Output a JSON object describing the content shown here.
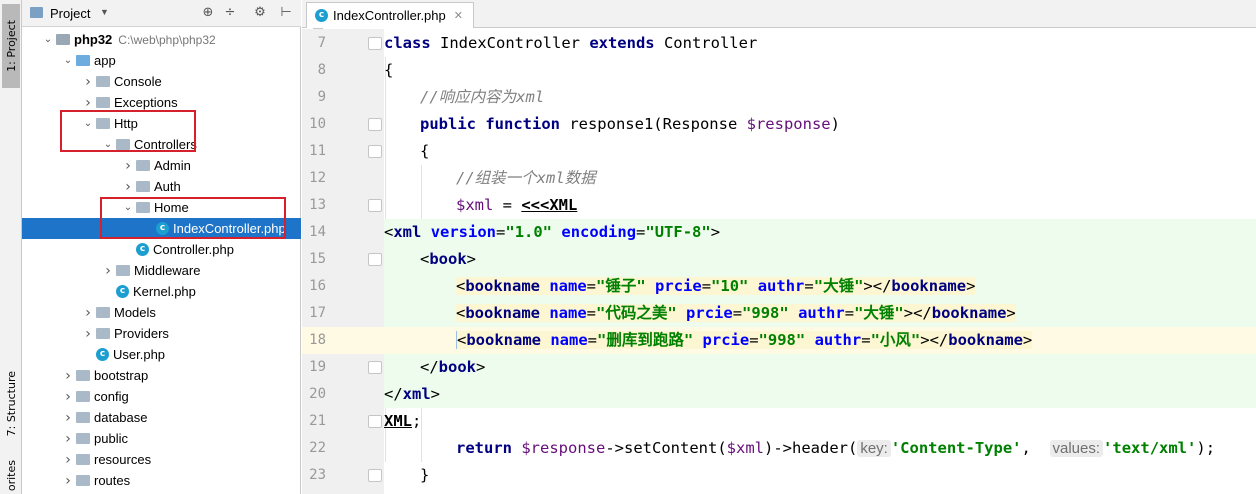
{
  "left_strip": {
    "project_tab": "1: Project",
    "structure_tab": "7: Structure",
    "favorites_tab": "orites"
  },
  "project_panel": {
    "title": "Project",
    "header_icons": [
      "target-icon",
      "collapse-icon",
      "gear-icon",
      "hide-icon"
    ],
    "tree": [
      {
        "label": "php32",
        "path": "C:\\web\\php\\php32",
        "depth": 0,
        "expanded": true,
        "type": "project",
        "bold": true
      },
      {
        "label": "app",
        "depth": 1,
        "expanded": true,
        "type": "folder-blue"
      },
      {
        "label": "Console",
        "depth": 2,
        "expanded": false,
        "type": "folder"
      },
      {
        "label": "Exceptions",
        "depth": 2,
        "expanded": false,
        "type": "folder"
      },
      {
        "label": "Http",
        "depth": 2,
        "expanded": true,
        "type": "folder"
      },
      {
        "label": "Controllers",
        "depth": 3,
        "expanded": true,
        "type": "folder"
      },
      {
        "label": "Admin",
        "depth": 4,
        "expanded": false,
        "type": "folder"
      },
      {
        "label": "Auth",
        "depth": 4,
        "expanded": false,
        "type": "folder"
      },
      {
        "label": "Home",
        "depth": 4,
        "expanded": true,
        "type": "folder"
      },
      {
        "label": "IndexController.php",
        "depth": 5,
        "type": "class",
        "selected": true
      },
      {
        "label": "Controller.php",
        "depth": 4,
        "type": "class"
      },
      {
        "label": "Middleware",
        "depth": 3,
        "expanded": false,
        "type": "folder"
      },
      {
        "label": "Kernel.php",
        "depth": 3,
        "type": "class"
      },
      {
        "label": "Models",
        "depth": 2,
        "expanded": false,
        "type": "folder"
      },
      {
        "label": "Providers",
        "depth": 2,
        "expanded": false,
        "type": "folder"
      },
      {
        "label": "User.php",
        "depth": 2,
        "type": "class"
      },
      {
        "label": "bootstrap",
        "depth": 1,
        "expanded": false,
        "type": "folder"
      },
      {
        "label": "config",
        "depth": 1,
        "expanded": false,
        "type": "folder"
      },
      {
        "label": "database",
        "depth": 1,
        "expanded": false,
        "type": "folder"
      },
      {
        "label": "public",
        "depth": 1,
        "expanded": false,
        "type": "folder"
      },
      {
        "label": "resources",
        "depth": 1,
        "expanded": false,
        "type": "folder"
      },
      {
        "label": "routes",
        "depth": 1,
        "expanded": false,
        "type": "folder"
      }
    ]
  },
  "editor": {
    "tab_label": "IndexController.php",
    "current_line": 18,
    "lines": [
      {
        "n": "7",
        "fold": true,
        "indent": 0,
        "segs": [
          [
            "kw",
            "class"
          ],
          [
            "t",
            " IndexController "
          ],
          [
            "kw",
            "extends"
          ],
          [
            "t",
            " Controller"
          ]
        ]
      },
      {
        "n": "8",
        "fold": false,
        "indent": 0,
        "segs": [
          [
            "t",
            "{"
          ]
        ]
      },
      {
        "n": "9",
        "fold": false,
        "indent": 1,
        "segs": [
          [
            "cmt",
            "//响应内容为xml"
          ]
        ]
      },
      {
        "n": "10",
        "fold": true,
        "indent": 1,
        "segs": [
          [
            "kw",
            "public function"
          ],
          [
            "t",
            " response1(Response "
          ],
          [
            "var",
            "$response"
          ],
          [
            "t",
            ")"
          ]
        ]
      },
      {
        "n": "11",
        "fold": true,
        "indent": 1,
        "segs": [
          [
            "t",
            "{"
          ]
        ]
      },
      {
        "n": "12",
        "fold": false,
        "indent": 2,
        "segs": [
          [
            "cmt",
            "//组装一个xml数据"
          ]
        ]
      },
      {
        "n": "13",
        "fold": true,
        "indent": 2,
        "segs": [
          [
            "var",
            "$xml"
          ],
          [
            "t",
            " = "
          ],
          [
            "heredoc",
            "<<<XML"
          ]
        ]
      },
      {
        "n": "14",
        "fold": false,
        "indent": 0,
        "bg": "green",
        "segs": [
          [
            "t",
            "<"
          ],
          [
            "tag",
            "xml"
          ],
          [
            "t",
            " "
          ],
          [
            "attr",
            "version"
          ],
          [
            "t",
            "="
          ],
          [
            "str",
            "\"1.0\""
          ],
          [
            "t",
            " "
          ],
          [
            "attr",
            "encoding"
          ],
          [
            "t",
            "="
          ],
          [
            "str",
            "\"UTF-8\""
          ],
          [
            "t",
            ">"
          ]
        ]
      },
      {
        "n": "15",
        "fold": true,
        "indent": 1,
        "bg": "green",
        "segs": [
          [
            "t",
            "<"
          ],
          [
            "tag",
            "book"
          ],
          [
            "t",
            ">"
          ]
        ]
      },
      {
        "n": "16",
        "fold": false,
        "indent": 2,
        "bg": "green",
        "yel": true,
        "segs": [
          [
            "t",
            "<"
          ],
          [
            "tag",
            "bookname"
          ],
          [
            "t",
            " "
          ],
          [
            "attr",
            "name"
          ],
          [
            "t",
            "="
          ],
          [
            "str",
            "\"锤子\""
          ],
          [
            "t",
            " "
          ],
          [
            "attr",
            "prcie"
          ],
          [
            "t",
            "="
          ],
          [
            "str",
            "\"10\""
          ],
          [
            "t",
            " "
          ],
          [
            "attr",
            "authr"
          ],
          [
            "t",
            "="
          ],
          [
            "str",
            "\"大锤\""
          ],
          [
            "t",
            "></"
          ],
          [
            "tag",
            "bookname"
          ],
          [
            "t",
            ">"
          ]
        ]
      },
      {
        "n": "17",
        "fold": false,
        "indent": 2,
        "bg": "green",
        "yel": true,
        "segs": [
          [
            "t",
            "<"
          ],
          [
            "tag",
            "bookname"
          ],
          [
            "t",
            " "
          ],
          [
            "attr",
            "name"
          ],
          [
            "t",
            "="
          ],
          [
            "str",
            "\"代码之美\""
          ],
          [
            "t",
            " "
          ],
          [
            "attr",
            "prcie"
          ],
          [
            "t",
            "="
          ],
          [
            "str",
            "\"998\""
          ],
          [
            "t",
            " "
          ],
          [
            "attr",
            "authr"
          ],
          [
            "t",
            "="
          ],
          [
            "str",
            "\"大锤\""
          ],
          [
            "t",
            "></"
          ],
          [
            "tag",
            "bookname"
          ],
          [
            "t",
            ">"
          ]
        ]
      },
      {
        "n": "18",
        "fold": false,
        "indent": 2,
        "bg": "current",
        "bulb": true,
        "segs": [
          [
            "t",
            "<"
          ],
          [
            "tag",
            "bookname"
          ],
          [
            "t",
            " "
          ],
          [
            "attr",
            "name"
          ],
          [
            "t",
            "="
          ],
          [
            "str",
            "\"删库到跑路\""
          ],
          [
            "t",
            " "
          ],
          [
            "attr",
            "prcie"
          ],
          [
            "t",
            "="
          ],
          [
            "str",
            "\"998\""
          ],
          [
            "t",
            " "
          ],
          [
            "attr",
            "authr"
          ],
          [
            "t",
            "="
          ],
          [
            "str",
            "\"小风\""
          ],
          [
            "t",
            "></"
          ],
          [
            "tag",
            "bookname"
          ],
          [
            "t",
            ">"
          ]
        ]
      },
      {
        "n": "19",
        "fold": true,
        "indent": 1,
        "bg": "green",
        "segs": [
          [
            "t",
            "</"
          ],
          [
            "tag",
            "book"
          ],
          [
            "t",
            ">"
          ]
        ]
      },
      {
        "n": "20",
        "fold": false,
        "indent": 0,
        "bg": "green",
        "segs": [
          [
            "t",
            "</"
          ],
          [
            "tag",
            "xml"
          ],
          [
            "t",
            ">"
          ]
        ]
      },
      {
        "n": "21",
        "fold": true,
        "indent": 0,
        "segs": [
          [
            "heredoc",
            "XML"
          ],
          [
            "t",
            ";"
          ]
        ]
      },
      {
        "n": "22",
        "fold": false,
        "indent": 2,
        "segs": [
          [
            "kw",
            "return"
          ],
          [
            "t",
            " "
          ],
          [
            "var",
            "$response"
          ],
          [
            "t",
            "->setContent("
          ],
          [
            "var",
            "$xml"
          ],
          [
            "t",
            ")->header("
          ],
          [
            "hint",
            "key:"
          ],
          [
            "str",
            "'Content-Type'"
          ],
          [
            "t",
            ",  "
          ],
          [
            "hint",
            "values:"
          ],
          [
            "str",
            "'text/xml'"
          ],
          [
            "t",
            ");"
          ]
        ]
      },
      {
        "n": "23",
        "fold": true,
        "indent": 1,
        "segs": [
          [
            "t",
            "}"
          ]
        ]
      }
    ]
  }
}
